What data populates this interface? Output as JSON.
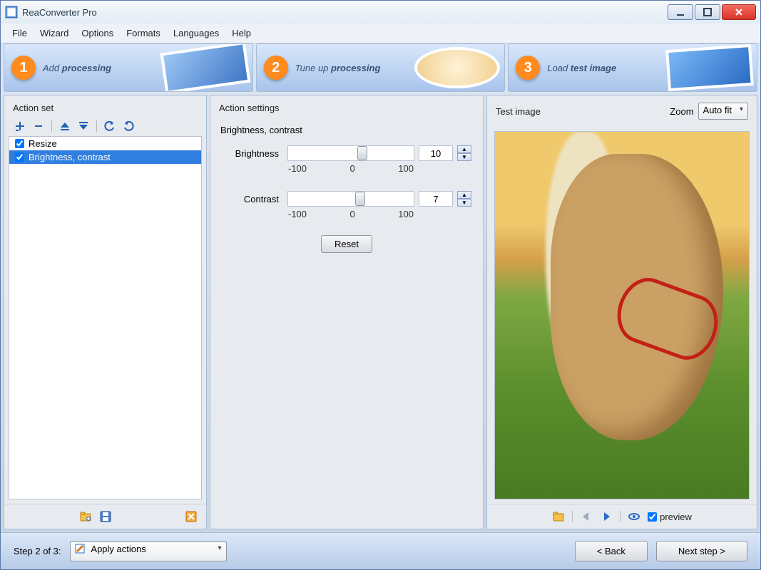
{
  "window": {
    "title": "ReaConverter Pro"
  },
  "menu": [
    "File",
    "Wizard",
    "Options",
    "Formats",
    "Languages",
    "Help"
  ],
  "steps": [
    {
      "num": "1",
      "prefix": "Add ",
      "bold": "processing"
    },
    {
      "num": "2",
      "prefix": "Tune up ",
      "bold": "processing"
    },
    {
      "num": "3",
      "prefix": "Load ",
      "bold": "test image"
    }
  ],
  "left": {
    "header": "Action set",
    "items": [
      {
        "label": "Resize",
        "checked": true,
        "selected": false
      },
      {
        "label": "Brightness, contrast",
        "checked": true,
        "selected": true
      }
    ]
  },
  "mid": {
    "header": "Action settings",
    "section": "Brightness, contrast",
    "brightness": {
      "label": "Brightness",
      "value": "10",
      "min": "-100",
      "zero": "0",
      "max": "100",
      "pos": 55
    },
    "contrast": {
      "label": "Contrast",
      "value": "7",
      "min": "-100",
      "zero": "0",
      "max": "100",
      "pos": 53.5
    },
    "reset": "Reset"
  },
  "right": {
    "header": "Test image",
    "zoom_label": "Zoom",
    "zoom_value": "Auto fit",
    "preview_label": "preview",
    "preview_checked": true
  },
  "bottom": {
    "step_text": "Step 2 of 3:",
    "dropdown": "Apply actions",
    "back": "< Back",
    "next": "Next step >"
  }
}
